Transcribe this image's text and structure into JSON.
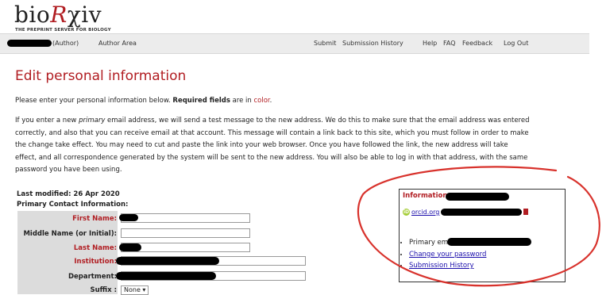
{
  "header": {
    "logo_prefix": "bio",
    "logo_r": "R",
    "logo_suffix": "χiv",
    "tagline": "THE PREPRINT SERVER FOR BIOLOGY"
  },
  "nav": {
    "author_tag": "(Author)",
    "author_area": "Author Area",
    "submit": "Submit",
    "submission_history": "Submission History",
    "help": "Help",
    "faq": "FAQ",
    "feedback": "Feedback",
    "logout": "Log Out"
  },
  "page": {
    "title": "Edit personal information",
    "intro_start": "Please enter your personal information below. ",
    "intro_required": "Required fields",
    "intro_mid": " are in ",
    "intro_color": "color",
    "intro_end": ".",
    "email_note_a": "If you enter a new ",
    "email_note_em": "primary",
    "email_note_b": " email address, we will send a test message to the new address. We do this to make sure that the email address was entered correctly, and also that you can receive email at that account. This message will contain a link back to this site, which you must follow in order to make the change take effect. You may need to cut and paste the link into your web browser. Once you have followed the link, the new address will take effect, and all correspondence generated by the system will be sent to the new address. You will also be able to log in with that address, with the same password you have been using.",
    "last_modified": "Last modified: 26 Apr 2020",
    "primary_contact": "Primary Contact Information:"
  },
  "form": {
    "first_name_label": "First Name:",
    "middle_name_label": "Middle Name (or Initial):",
    "last_name_label": "Last Name:",
    "institution_label": "Institution:",
    "department_label": "Department:",
    "suffix_label": "Suffix :",
    "suffix_value": "None ▾"
  },
  "info": {
    "heading": "Information",
    "orcid_text": "orcid.org",
    "primary_email": "Primary email",
    "change_password": "Change your password",
    "submission_history": "Submission History"
  },
  "colors": {
    "accent": "#b11d22",
    "link": "#1a0dab",
    "annotation": "#d8322c"
  }
}
